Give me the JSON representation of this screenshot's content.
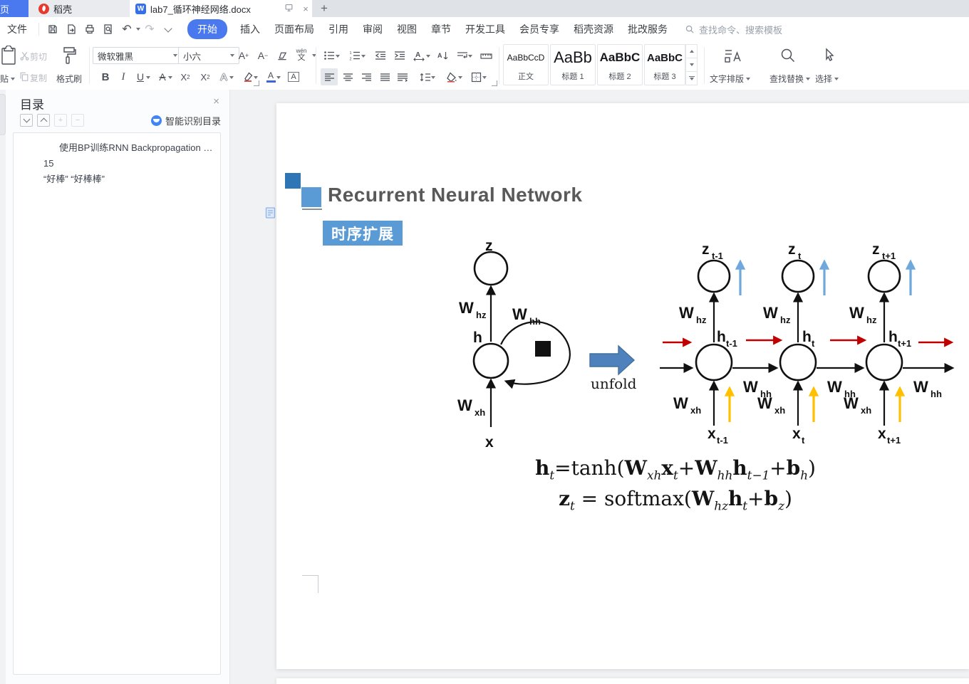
{
  "window": {
    "tabs": [
      {
        "label": "首页"
      },
      {
        "label": "稻壳"
      },
      {
        "label": "lab7_循环神经网络.docx"
      }
    ],
    "new_tab": "+",
    "close_glyph": "×"
  },
  "menu": {
    "file": "文件",
    "active": "开始",
    "items": [
      "插入",
      "页面布局",
      "引用",
      "审阅",
      "视图",
      "章节",
      "开发工具",
      "会员专享",
      "稻壳资源",
      "批改服务"
    ],
    "search": "查找命令、搜索模板"
  },
  "ribbon": {
    "paste": "贴",
    "cut": "剪切",
    "copy": "复制",
    "format_painter": "格式刷",
    "font_name": "微软雅黑",
    "font_size": "小六",
    "styles": [
      {
        "preview": "AaBbCcD",
        "name": "正文"
      },
      {
        "preview": "AaBb",
        "name": "标题 1"
      },
      {
        "preview": "AaBbC",
        "name": "标题 2"
      },
      {
        "preview": "AaBbC",
        "name": "标题 3"
      }
    ],
    "text_layout": "文字排版",
    "find_replace": "查找替换",
    "select": "选择"
  },
  "glyphs": {
    "w_logo": "W",
    "letter_a": "A",
    "plus": "+",
    "minus": "−",
    "bold": "B",
    "italic": "I",
    "underline": "U",
    "strike_a": "A",
    "x_base": "X",
    "two": "2",
    "hollow_a": "A",
    "color_a": "A",
    "boxed_a": "A",
    "wen_top": "wén",
    "wen_char": "文",
    "undo": "↶",
    "redo": "↷"
  },
  "sidebar": {
    "title": "目录",
    "smart_label": "智能识别目录",
    "items": [
      {
        "text": "使用BP训练RNN Backpropagation th ..."
      },
      {
        "text": "15"
      },
      {
        "text": "“好棒” “好棒棒”"
      }
    ]
  },
  "doc": {
    "title": "Recurrent Neural Network",
    "badge": "时序扩展",
    "diagram": {
      "unfold": "unfold",
      "fold": {
        "z": "z",
        "h": "h",
        "x": "x",
        "whz": {
          "b": "W",
          "s": "hz"
        },
        "whh": {
          "b": "W",
          "s": "hh"
        },
        "wxh": {
          "b": "W",
          "s": "xh"
        }
      },
      "cols": [
        {
          "z": "z",
          "zs": "t-1",
          "h": "h",
          "hs": "t-1",
          "x": "x",
          "xs": "t-1",
          "w": "W",
          "whz": "hz",
          "whh": "hh",
          "wxh": "xh"
        },
        {
          "z": "z",
          "zs": "t",
          "h": "h",
          "hs": "t",
          "x": "x",
          "xs": "t",
          "w": "W",
          "whz": "hz",
          "whh": "hh",
          "wxh": "xh"
        },
        {
          "z": "z",
          "zs": "t+1",
          "h": "h",
          "hs": "t+1",
          "x": "x",
          "xs": "t+1",
          "w": "W",
          "whz": "hz",
          "whh": "hh",
          "wxh": "xh"
        }
      ]
    },
    "formulas": {
      "line1": [
        {
          "t": "h",
          "b": 1
        },
        {
          "t": "t",
          "sub": 1,
          "i": 1
        },
        {
          "t": "=tanh("
        },
        {
          "t": "W",
          "b": 1
        },
        {
          "t": "xh",
          "sub": 1,
          "i": 1
        },
        {
          "t": "x",
          "b": 1
        },
        {
          "t": "t",
          "sub": 1,
          "i": 1
        },
        {
          "t": "+"
        },
        {
          "t": "W",
          "b": 1
        },
        {
          "t": "hh",
          "sub": 1,
          "i": 1
        },
        {
          "t": "h",
          "b": 1
        },
        {
          "t": "t−1",
          "sub": 1,
          "i": 1
        },
        {
          "t": "+"
        },
        {
          "t": "b",
          "b": 1
        },
        {
          "t": "h",
          "sub": 1,
          "i": 1
        },
        {
          "t": ")"
        }
      ],
      "line2": [
        {
          "t": "z",
          "b": 1
        },
        {
          "t": "t",
          "sub": 1,
          "i": 1
        },
        {
          "t": " = softmax("
        },
        {
          "t": "W",
          "b": 1
        },
        {
          "t": "hz",
          "sub": 1,
          "i": 1
        },
        {
          "t": "h",
          "b": 1
        },
        {
          "t": "t",
          "sub": 1,
          "i": 1
        },
        {
          "t": "+"
        },
        {
          "t": "b",
          "b": 1
        },
        {
          "t": "z",
          "sub": 1,
          "i": 1
        },
        {
          "t": ")"
        }
      ]
    }
  },
  "colors": {
    "accent_blue": "#4a78ee",
    "slide_blue": "#5b9bd5",
    "dark_square": "#2e75b6",
    "unfold_arrow_fill": "#4f81bd",
    "red_arrow": "#c00000",
    "yellow_arrow": "#ffc000",
    "light_blue_arrow": "#6fa8dc",
    "title_gray": "#595959",
    "docer_red": "#e6392f"
  }
}
